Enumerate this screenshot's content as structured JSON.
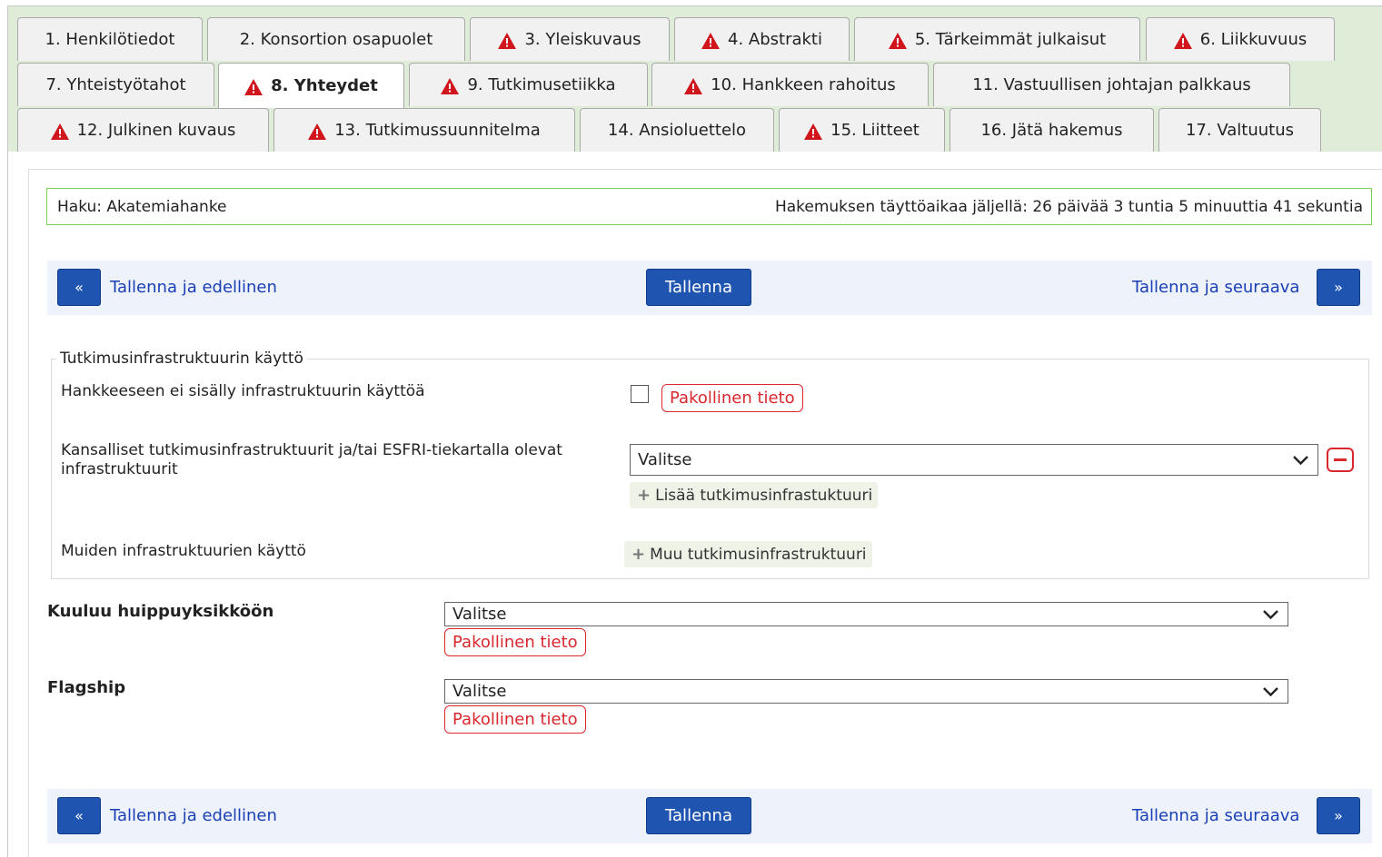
{
  "tabs": [
    {
      "label": "1. Henkilötiedot",
      "warning": false,
      "active": false
    },
    {
      "label": "2. Konsortion osapuolet",
      "warning": false,
      "active": false
    },
    {
      "label": "3. Yleiskuvaus",
      "warning": true,
      "active": false
    },
    {
      "label": "4. Abstrakti",
      "warning": true,
      "active": false
    },
    {
      "label": "5. Tärkeimmät julkaisut",
      "warning": true,
      "active": false
    },
    {
      "label": "6. Liikkuvuus",
      "warning": true,
      "active": false
    },
    {
      "label": "7. Yhteistyötahot",
      "warning": false,
      "active": false
    },
    {
      "label": "8. Yhteydet",
      "warning": true,
      "active": true
    },
    {
      "label": "9. Tutkimusetiikka",
      "warning": true,
      "active": false
    },
    {
      "label": "10. Hankkeen rahoitus",
      "warning": true,
      "active": false
    },
    {
      "label": "11. Vastuullisen johtajan palkkaus",
      "warning": false,
      "active": false
    },
    {
      "label": "12. Julkinen kuvaus",
      "warning": true,
      "active": false
    },
    {
      "label": "13. Tutkimussuunnitelma",
      "warning": true,
      "active": false
    },
    {
      "label": "14. Ansioluettelo",
      "warning": false,
      "active": false
    },
    {
      "label": "15. Liitteet",
      "warning": true,
      "active": false
    },
    {
      "label": "16. Jätä hakemus",
      "warning": false,
      "active": false
    },
    {
      "label": "17. Valtuutus",
      "warning": false,
      "active": false
    }
  ],
  "header": {
    "call": "Haku: Akatemiahanke",
    "time_left": "Hakemuksen täyttöaikaa jäljellä: 26 päivää 3 tuntia 5 minuuttia 41 sekuntia"
  },
  "nav": {
    "prev_icon": "«",
    "prev_label": "Tallenna ja edellinen",
    "save_label": "Tallenna",
    "next_label": "Tallenna ja seuraava",
    "next_icon": "»"
  },
  "infra": {
    "legend": "Tutkimusinfrastruktuurin käyttö",
    "no_infra_label": "Hankkeeseen ei sisälly infrastruktuurin käyttöä",
    "required_label": "Pakollinen tieto",
    "national_label_line1": "Kansalliset tutkimusinfrastruktuurit ja/tai ESFRI-tiekartalla olevat",
    "national_label_line2": "infrastruktuurit",
    "national_select_value": "Valitse",
    "add_infra_label": "Lisää tutkimusinfrastuktuuri",
    "other_label": "Muiden infrastruktuurien käyttö",
    "other_add_label": "Muu tutkimusinfrastruktuuri"
  },
  "huippu": {
    "label": "Kuuluu huippuyksikköön",
    "select_value": "Valitse",
    "required_label": "Pakollinen tieto"
  },
  "flagship": {
    "label": "Flagship",
    "select_value": "Valitse",
    "required_label": "Pakollinen tieto"
  },
  "colors": {
    "tab_bar": "#dfecd8",
    "primary_button": "#1f55b0",
    "link": "#1a3fb4",
    "required": "#d9272e",
    "warning": "#d0161c",
    "haku_border": "#7bcf55"
  },
  "icons": {
    "warning": "warning-triangle-icon",
    "dropdown": "chevron-down-icon",
    "remove": "minus-icon",
    "add": "plus-icon"
  }
}
